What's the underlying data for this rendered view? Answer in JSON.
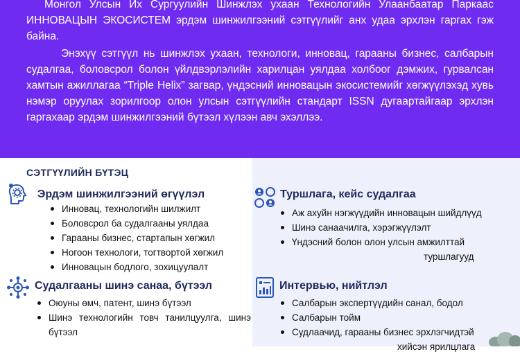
{
  "intro": {
    "paragraph1": "Монгол Улсын Их Сургуулийн Шинжлэх ухаан Технологийн Улаанбаатар Паркаас ИННОВАЦЫН ЭКОСИСТЕМ эрдэм шинжилгээний сэтгүүлийг анх удаа эрхлэн гаргах гэж байна.",
    "paragraph2": "Энэхүү сэтгүүл нь шинжлэх ухаан, технологи, инновац, гарааны бизнес, салбарын судалгаа, боловсрол болон үйлдвэрлэлийн харилцан уялдаа холбоог дэмжих, гурвалсан хамтын ажиллагаа “Triple Helix” загвар, үндэсний инновацын экосистемийг хөгжүүлэхэд хувь нэмэр оруулах зорилгоор олон улсын сэтгүүлийн стандарт ISSN дугаартайгаар эрхлэн гаргахаар эрдэм шинжилгээний бүтээл хүлээн авч эхэллээ."
  },
  "structure_title": "СЭТГҮҮЛИЙН БҮТЭЦ",
  "sections": {
    "research": {
      "title": "Эрдэм шинжилгээний өгүүлэл",
      "items": [
        "Инновац, технологийн шилжилт",
        "Боловсрол ба судалгааны уялдаа",
        "Гарааны бизнес, стартапын хөгжил",
        "Ногоон технологи, тогтвортой хөгжил",
        "Инновацын бодлого, зохицуулалт"
      ]
    },
    "experience": {
      "title": "Туршлага, кейс судалгаа",
      "items": [
        "Аж ахуйн нэгжүүдийн инновацын  шийдлүүд",
        "Шинэ санаачилга, хэрэгжүүлэлт",
        "Үндэсний болон олон улсын амжилттай",
        "туршлагууд"
      ]
    },
    "ideas": {
      "title": "Судалгааны шинэ санаа, бүтээл",
      "items": [
        "Оюуны өмч, патент, шинэ бүтээл",
        "Шинэ технологийн товч танилцуулга, шинэ бүтээл"
      ]
    },
    "interview": {
      "title": "Интервью, нийтлэл",
      "items": [
        "Салбарын экспертүүдийн санал, бодол",
        "Салбарын тойм",
        "Судлаачид, гарааны бизнес эрхлэгчидтэй",
        "хийсэн  ярилцлага"
      ]
    }
  },
  "colors": {
    "intro_bg": "#6f2cf0",
    "heading": "#1f2a5c",
    "icon": "#2b55b8",
    "right_panel": "#eef0fb"
  }
}
